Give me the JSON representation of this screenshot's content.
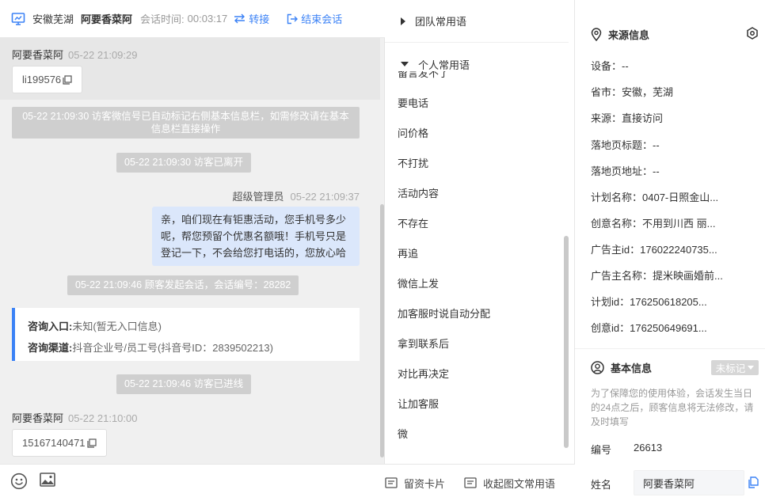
{
  "header": {
    "region": "安徽芜湖",
    "visitor_name": "阿要香菜阿",
    "time_label": "会话时间:",
    "time_value": "00:03:17",
    "transfer_label": "转接",
    "end_label": "结束会话"
  },
  "messages": {
    "m1": {
      "sender": "阿要香菜阿",
      "timestamp": "05-22 21:09:29",
      "text": "li199576"
    },
    "sys1": "05-22 21:09:30 访客微信号已自动标记右侧基本信息栏，如需修改请在基本信息栏直接操作",
    "sys2": "05-22 21:09:30 访客已离开",
    "m2": {
      "sender": "超级管理员",
      "timestamp": "05-22 21:09:37",
      "text": "亲，咱们现在有钜惠活动，您手机号多少呢，帮您预留个优惠名额哦！手机号只是登记一下，不会给您打电话的，您放心哈"
    },
    "sys3": "05-22 21:09:46 顾客发起会话，会话编号：28282",
    "card": {
      "entry_label": "咨询入口:",
      "entry_value": "未知(暂无入口信息)",
      "channel_label": "咨询渠道:",
      "channel_value": "抖音企业号/员工号(抖音号ID：2839502213)"
    },
    "sys4": "05-22 21:09:46 访客已进线",
    "m3": {
      "sender": "阿要香菜阿",
      "timestamp": "05-22 21:10:00",
      "text": "15167140471"
    }
  },
  "bottom": {
    "card_label": "留资卡片",
    "collapse_label": "收起图文常用语"
  },
  "phrases": {
    "team_group": "团队常用语",
    "personal_group": "个人常用语",
    "cut_item": "留言发不了",
    "items": [
      "要电话",
      "问价格",
      "不打扰",
      "活动内容",
      "不存在",
      "再追",
      "微信上发",
      "加客服时说自动分配",
      "拿到联系后",
      "对比再决定",
      "让加客服",
      "微"
    ]
  },
  "info": {
    "source_title": "来源信息",
    "device": "设备：--",
    "province": "省市：安徽，芜湖",
    "source": "来源：直接访问",
    "landing_title": "落地页标题：--",
    "landing_url": "落地页地址：--",
    "plan_name": "计划名称：0407-日照金山...",
    "creative_name": "创意名称：不用到川西 丽...",
    "advertiser_id": "广告主id：176022240735...",
    "advertiser_name": "广告主名称：提米映画婚前...",
    "plan_id": "计划id：176250618205...",
    "creative_id": "创意id：176250649691...",
    "basic_title": "基本信息",
    "tag_label": "未标记",
    "notice": "为了保障您的使用体验，会话发生当日的24点之后，顾客信息将无法修改，请及时填写",
    "number_label": "编号",
    "number_value": "26613",
    "name_label": "姓名",
    "name_value": "阿要香菜阿"
  },
  "colors": {
    "accent": "#3b82f6",
    "agent_bubble": "#dbe7fb",
    "system_note": "#cfcfcf"
  }
}
